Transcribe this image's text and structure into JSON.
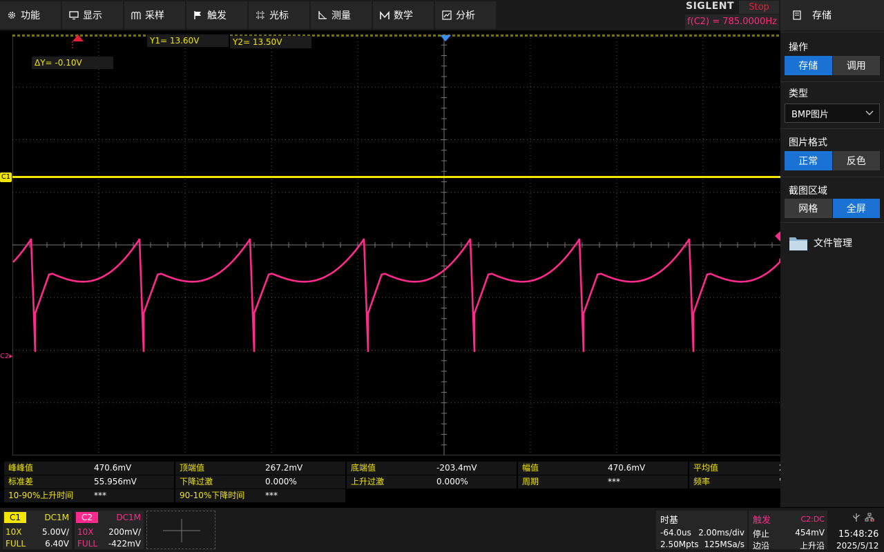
{
  "menu": [
    {
      "label": "功能",
      "icon": "gear-icon"
    },
    {
      "label": "显示",
      "icon": "monitor-icon"
    },
    {
      "label": "采样",
      "icon": "acquire-icon"
    },
    {
      "label": "触发",
      "icon": "flag-icon"
    },
    {
      "label": "光标",
      "icon": "crosshair-icon"
    },
    {
      "label": "测量",
      "icon": "ruler-icon"
    },
    {
      "label": "数学",
      "icon": "math-icon"
    },
    {
      "label": "分析",
      "icon": "analyze-icon"
    }
  ],
  "brand": {
    "logo": "SIGLENT",
    "run_state": "Stop",
    "freq": "f(C2) = 785.0000Hz"
  },
  "panel": {
    "title": "存储",
    "title_icon": "save-icon",
    "operation": {
      "title": "操作",
      "options": [
        "存储",
        "调用"
      ],
      "selected": 0
    },
    "type": {
      "title": "类型",
      "value": "BMP图片"
    },
    "format": {
      "title": "图片格式",
      "options": [
        "正常",
        "反色"
      ],
      "selected": 0
    },
    "region": {
      "title": "截图区域",
      "options": [
        "网格",
        "全屏"
      ],
      "selected": 1
    },
    "file_manager": "文件管理"
  },
  "cursors": {
    "y1": "Y1= 13.60V",
    "y2": "Y2= 13.50V",
    "dy": "ΔY= -0.10V"
  },
  "markers": {
    "c1": "C1",
    "c2": "C2"
  },
  "colors": {
    "ch1": "#f2e700",
    "ch2": "#ff2a8c",
    "accent": "#1a72d4",
    "stop": "#e0203a"
  },
  "measurements": [
    [
      {
        "name": "峰峰值",
        "value": "470.6mV"
      },
      {
        "name": "顶端值",
        "value": "267.2mV"
      },
      {
        "name": "底端值",
        "value": "-203.4mV"
      },
      {
        "name": "幅值",
        "value": "470.6mV"
      },
      {
        "name": "平均值",
        "value": "2"
      }
    ],
    [
      {
        "name": "标准差",
        "value": "55.956mV"
      },
      {
        "name": "下降过激",
        "value": "0.000%"
      },
      {
        "name": "上升过激",
        "value": "0.000%"
      },
      {
        "name": "周期",
        "value": "***"
      },
      {
        "name": "频率",
        "value": "'"
      }
    ],
    [
      {
        "name": "10-90%上升时间",
        "value": "***"
      },
      {
        "name": "90-10%下降时间",
        "value": "***"
      }
    ]
  ],
  "ch1": {
    "label": "C1",
    "coupling": "DC1M",
    "probe": "10X",
    "scale": "5.00V/",
    "bw": "FULL",
    "offset": "6.40V"
  },
  "ch2": {
    "label": "C2",
    "coupling": "DC1M",
    "probe": "10X",
    "scale": "200mV/",
    "bw": "FULL",
    "offset": "-422mV"
  },
  "timebase": {
    "title": "时基",
    "delay": "-64.0us",
    "scale": "2.00ms/div",
    "points": "2.50Mpts",
    "rate": "125MSa/s"
  },
  "trigger": {
    "title": "触发",
    "source": "C2:DC",
    "mode": "停止",
    "level": "454mV",
    "type": "边沿",
    "slope": "上升沿"
  },
  "clock": {
    "time": "15:48:26",
    "date": "2025/5/12"
  }
}
